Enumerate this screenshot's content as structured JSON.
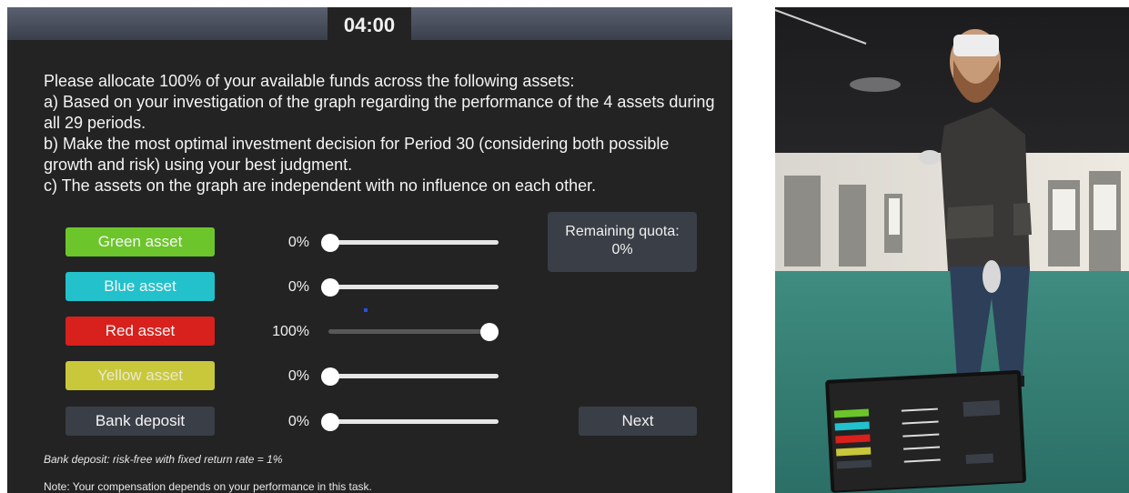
{
  "timer": "04:00",
  "instructions": [
    "Please allocate 100% of your available funds across the following assets:",
    "a) Based on your investigation of the graph regarding the performance of the 4 assets during all 29 periods.",
    "b) Make the most optimal investment decision for Period 30 (considering both possible growth and risk) using your best judgment.",
    "c) The assets on the graph are independent with no influence on each other."
  ],
  "assets": [
    {
      "label": "Green asset",
      "percent": "0%",
      "value": 0,
      "color": "#6cc52a"
    },
    {
      "label": "Blue asset",
      "percent": "0%",
      "value": 0,
      "color": "#22c1cc"
    },
    {
      "label": "Red asset",
      "percent": "100%",
      "value": 100,
      "color": "#d8201c"
    },
    {
      "label": "Yellow asset",
      "percent": "0%",
      "value": 0,
      "color": "#c9c83b"
    },
    {
      "label": "Bank deposit",
      "percent": "0%",
      "value": 0,
      "color": "#3a3e47"
    }
  ],
  "quota": {
    "title": "Remaining quota:",
    "value": "0%"
  },
  "next_label": "Next",
  "bank_note": "Bank deposit: risk-free with fixed return rate = 1%",
  "comp_note": "Note: Your compensation depends on your performance in this task.",
  "tablet": {
    "header_lines": [
      "with and risk) using your best judgment.",
      "The assets on the graph are independent with no influence on each other."
    ],
    "assets": [
      "Green asset",
      "Blue asset",
      "Red asset",
      "Yellow asset",
      "Bank deposit"
    ],
    "percents": [
      "20%",
      "10%",
      "20%",
      "20%",
      "0%"
    ],
    "quota": "Remaining quota: 10%",
    "next": "Next"
  }
}
